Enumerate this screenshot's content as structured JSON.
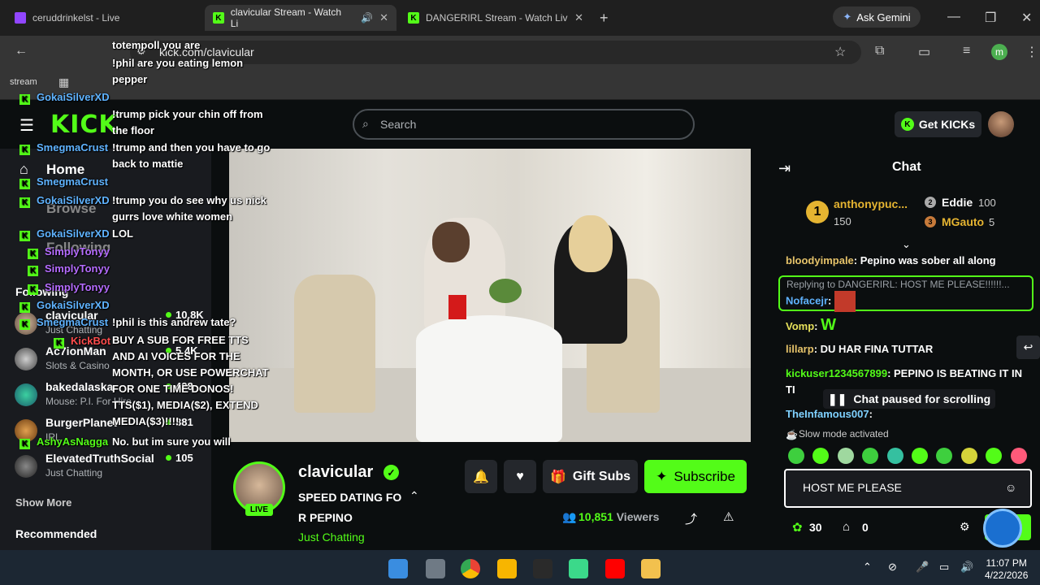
{
  "browser": {
    "tabs": [
      {
        "label": "ceruddrinkelst - Live"
      },
      {
        "label": "clavicular Stream - Watch Li"
      },
      {
        "label": "DANGERIRL Stream - Watch Liv"
      }
    ],
    "ask_gemini": "Ask Gemini",
    "url": "kick.com/clavicular",
    "profile_initial": "m",
    "bookmark_label": "stream"
  },
  "header": {
    "logo": "KICK",
    "search_placeholder": "Search",
    "get_kicks": "Get KICKs"
  },
  "sidebar": {
    "nav": {
      "home": "Home",
      "browse": "Browse",
      "following": "Following"
    },
    "following_heading": "Following",
    "channels": [
      {
        "name": "clavicular",
        "category": "Just Chatting",
        "viewers": "10.8K"
      },
      {
        "name": "Ac7ionMan",
        "category": "Slots & Casino",
        "viewers": "5.4K"
      },
      {
        "name": "bakedalaska",
        "category": "Mouse: P.I. For Hire",
        "viewers": "428"
      },
      {
        "name": "BurgerPlanet",
        "category": "IRL",
        "viewers": "381"
      },
      {
        "name": "ElevatedTruthSocial",
        "category": "Just Chatting",
        "viewers": "105"
      }
    ],
    "show_more": "Show More",
    "recommended": "Recommended"
  },
  "overlay_chat": [
    {
      "user": "",
      "msg": "totempoll you are"
    },
    {
      "user": "",
      "msg": "!phil are you eating lemon pepper"
    },
    {
      "user": "GokaiSilverXD",
      "msg": "!trump pick your chin off from the floor"
    },
    {
      "user": "SmegmaCrust",
      "msg": "!trump and then you have to go back to mattie"
    },
    {
      "user": "SmegmaCrust",
      "msg": ""
    },
    {
      "user": "GokaiSilverXD",
      "msg": "!trump you do see why us nick gurrs love white women"
    },
    {
      "user": "GokaiSilverXD",
      "msg": "LOL"
    },
    {
      "user": "SimplyTonyy",
      "msg": ""
    },
    {
      "user": "SimplyTonyy",
      "msg": ""
    },
    {
      "user": "SimplyTonyy",
      "msg": ""
    },
    {
      "user": "GokaiSilverXD",
      "msg": ""
    },
    {
      "user": "SmegmaCrust",
      "msg": "!phil is this andrew tate?"
    },
    {
      "user": "KickBot",
      "msg": "BUY A SUB FOR FREE TTS AND AI VOICES FOR THE MONTH, OR USE POWERCHAT FOR ONE TIME DONOS! TTS($1), MEDIA($2), EXTEND MEDIA($3)!!!!"
    },
    {
      "user": "AshyAsNagga",
      "msg": "No. but im sure you will"
    }
  ],
  "stream": {
    "name": "clavicular",
    "live": "LIVE",
    "title": "SPEED DATING FOR PEPINO",
    "category": "Just Chatting",
    "viewers": "10,851",
    "viewers_label": "Viewers",
    "gift_subs": "Gift Subs",
    "subscribe": "Subscribe"
  },
  "chat": {
    "title": "Chat",
    "leaderboard": [
      {
        "rank": "1",
        "name": "anthonypuc...",
        "value": "150"
      },
      {
        "rank": "2",
        "name": "Eddie",
        "value": "100"
      },
      {
        "rank": "3",
        "name": "MGauto",
        "value": "5"
      }
    ],
    "messages": [
      {
        "user": "bloodyimpale",
        "text": "Pepino was sober all along",
        "color": "#e6c36a"
      },
      {
        "user": "Nofacejr",
        "text": "",
        "color": "#5fb3ff",
        "reply": "Replying to DANGERIRL: HOST ME PLEASE!!!!!!..."
      },
      {
        "user": "Vomp",
        "text": "W",
        "color": "#e6e05a"
      },
      {
        "user": "lillarp",
        "text": "DU HAR FINA TUTTAR",
        "color": "#e6c36a"
      },
      {
        "user": "kickuser1234567899",
        "text": "PEPINO IS BEATING IT IN TI",
        "color": "#53fc18"
      },
      {
        "user": "TheInfamous007",
        "text": "",
        "color": "#7fd1ff"
      }
    ],
    "paused": "Chat paused for scrolling",
    "slow_mode": "Slow mode activated",
    "input_value": "HOST ME PLEASE",
    "points": "30",
    "store_count": "0"
  },
  "taskbar": {
    "time": "11:07 PM",
    "date": "4/22/2026"
  }
}
